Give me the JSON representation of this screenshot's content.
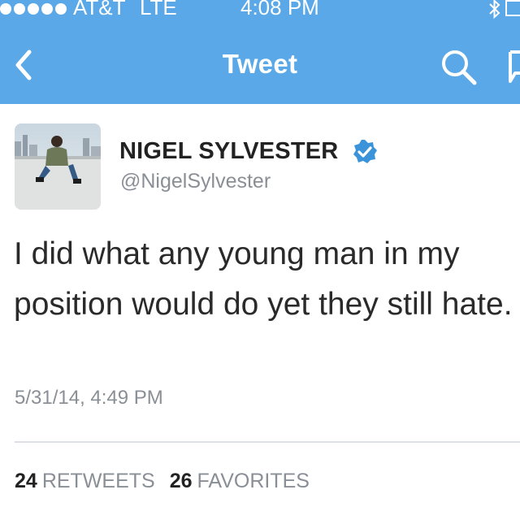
{
  "status_bar": {
    "carrier": "AT&T",
    "network": "LTE",
    "time": "4:08 PM",
    "signal_dots": 5,
    "icons": [
      "bluetooth-icon",
      "battery-icon"
    ]
  },
  "nav": {
    "title": "Tweet",
    "icons": [
      "back-chevron-icon",
      "search-icon",
      "compose-icon"
    ]
  },
  "tweet": {
    "author_name": "NIGEL SYLVESTER",
    "author_handle": "@NigelSylvester",
    "verified": true,
    "text": "I did what any young man in my position would do yet they still hate.",
    "timestamp": "5/31/14, 4:49 PM"
  },
  "stats": {
    "retweets_count": "24",
    "retweets_label": "RETWEETS",
    "favorites_count": "26",
    "favorites_label": "FAVORITES"
  },
  "colors": {
    "nav_bar": "#5aa8e8",
    "verified_badge": "#3b94d9",
    "name_text": "#222222",
    "secondary_text": "#8a8f96"
  }
}
